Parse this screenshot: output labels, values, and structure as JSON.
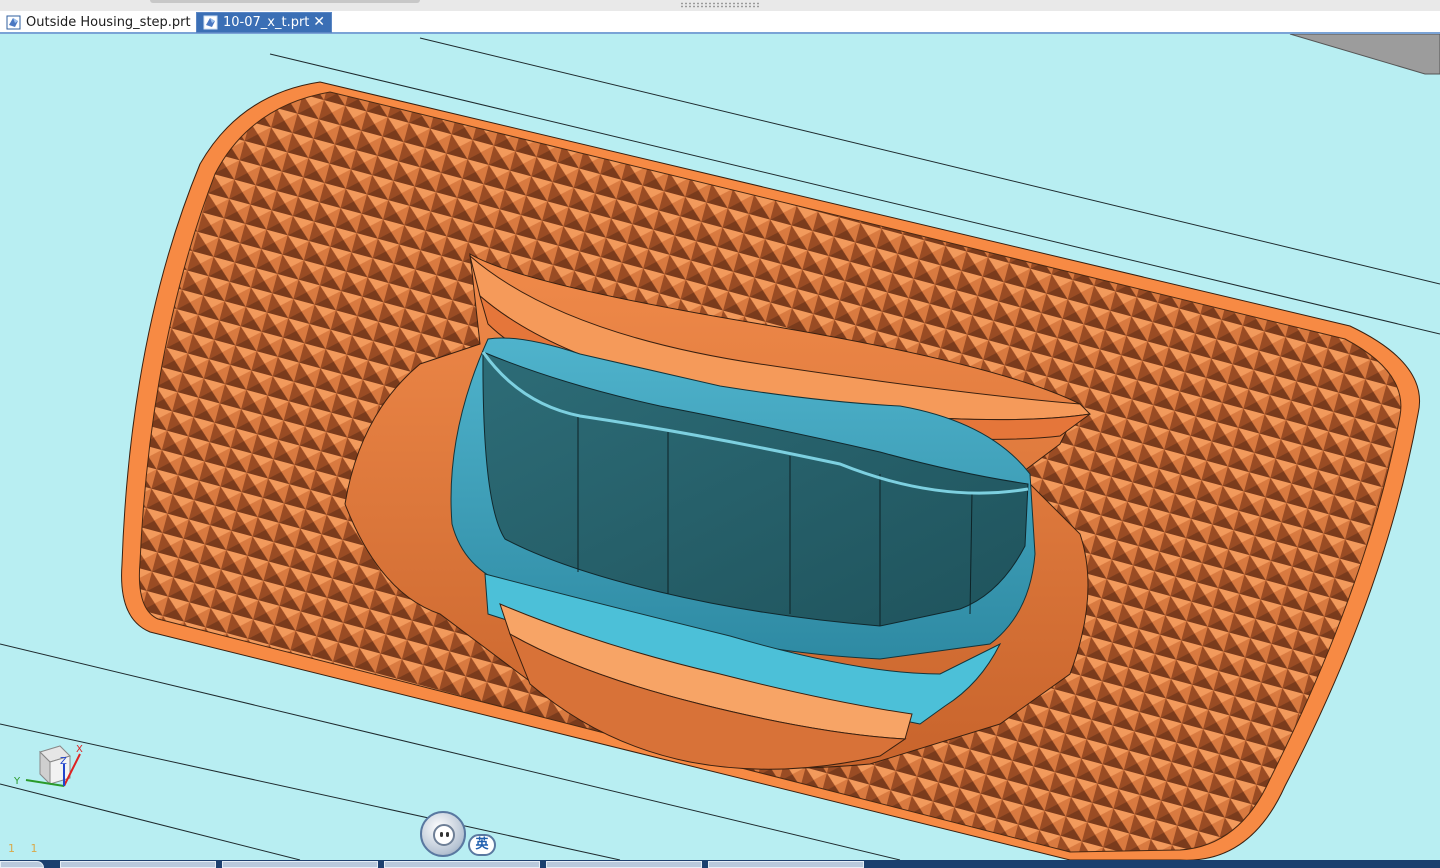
{
  "tabs": [
    {
      "label": "Outside Housing_step.prt",
      "active": false,
      "icon": "part-file-icon"
    },
    {
      "label": "10-07_x_t.prt",
      "active": true,
      "icon": "part-file-icon",
      "close_glyph": "✕"
    }
  ],
  "viewport": {
    "background_color": "#b8eef2",
    "model_orange": "#f78a44",
    "model_blue": "#3a9fb7",
    "model_dark": "#245c66"
  },
  "triad": {
    "axes": [
      "X",
      "Y",
      "Z"
    ],
    "icon": "view-triad-icon"
  },
  "status_text": "1 1",
  "ime": {
    "icon": "ime-mascot-icon",
    "language": "英"
  }
}
